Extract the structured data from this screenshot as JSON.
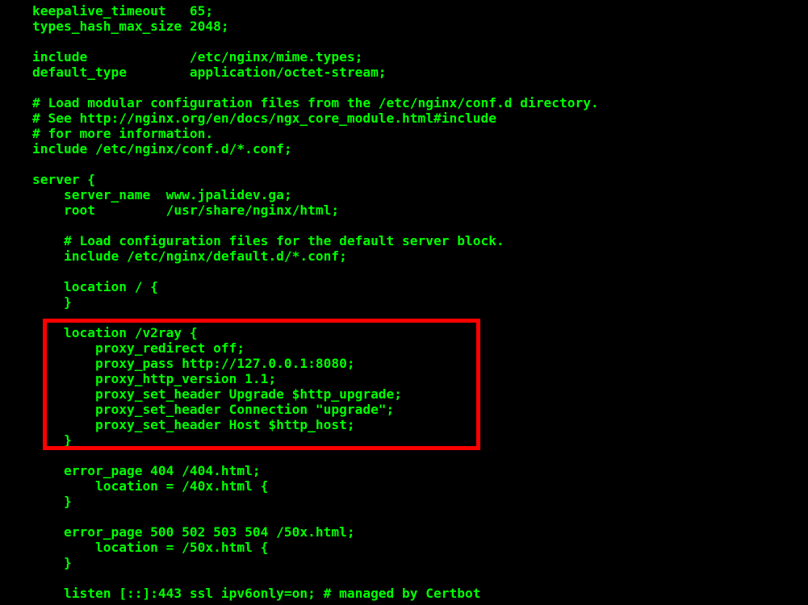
{
  "terminal": {
    "lines": [
      "keepalive_timeout   65;",
      "types_hash_max_size 2048;",
      "",
      "include             /etc/nginx/mime.types;",
      "default_type        application/octet-stream;",
      "",
      "# Load modular configuration files from the /etc/nginx/conf.d directory.",
      "# See http://nginx.org/en/docs/ngx_core_module.html#include",
      "# for more information.",
      "include /etc/nginx/conf.d/*.conf;",
      "",
      "server {",
      "    server_name  www.jpalidev.ga;",
      "    root         /usr/share/nginx/html;",
      "",
      "    # Load configuration files for the default server block.",
      "    include /etc/nginx/default.d/*.conf;",
      "",
      "    location / {",
      "    }",
      "",
      "    location /v2ray {",
      "        proxy_redirect off;",
      "        proxy_pass http://127.0.0.1:8080;",
      "        proxy_http_version 1.1;",
      "        proxy_set_header Upgrade $http_upgrade;",
      "        proxy_set_header Connection \"upgrade\";",
      "        proxy_set_header Host $http_host;",
      "    }",
      "",
      "    error_page 404 /404.html;",
      "        location = /40x.html {",
      "    }",
      "",
      "    error_page 500 502 503 504 /50x.html;",
      "        location = /50x.html {",
      "    }",
      "",
      "    listen [::]:443 ssl ipv6only=on; # managed by Certbot"
    ]
  },
  "highlight": {
    "description": "red rectangle highlighting the /v2ray location block"
  }
}
